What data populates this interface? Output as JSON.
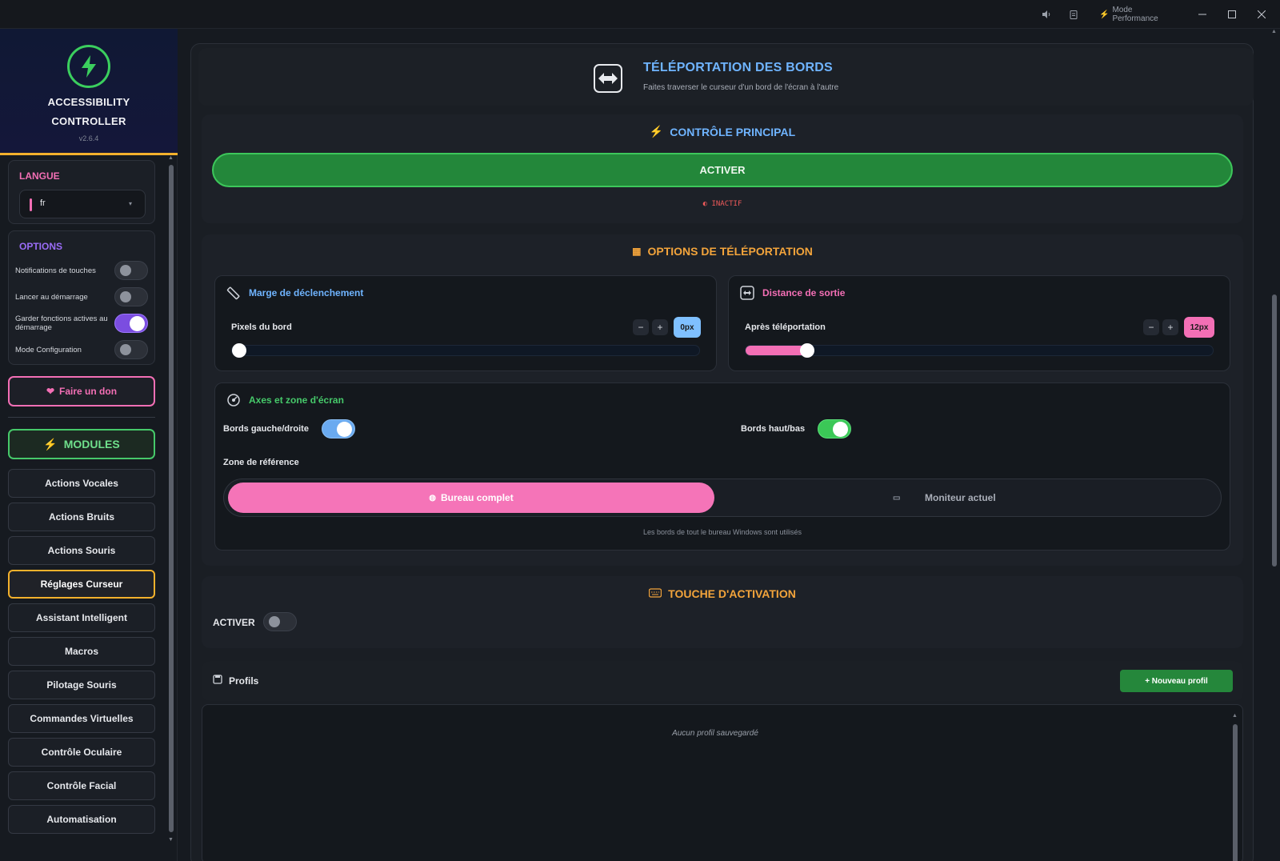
{
  "titlebar": {
    "perf_label": "Mode Performance",
    "icons": [
      "speaker-icon",
      "clipboard-icon",
      "bolt-icon",
      "minimize-icon",
      "maximize-icon",
      "close-icon"
    ]
  },
  "sidebar": {
    "brand_line1": "ACCESSIBILITY",
    "brand_line2": "CONTROLLER",
    "version": "v2.6.4",
    "language": {
      "title": "LANGUE",
      "value": "fr"
    },
    "options": {
      "title": "OPTIONS",
      "items": [
        {
          "label": "Notifications de touches",
          "on": false
        },
        {
          "label": "Lancer au démarrage",
          "on": false
        },
        {
          "label": "Garder fonctions actives au démarrage",
          "on": true
        },
        {
          "label": "Mode Configuration",
          "on": false
        }
      ]
    },
    "donate": "Faire un don",
    "modules_label": "MODULES",
    "modules": [
      "Actions Vocales",
      "Actions Bruits",
      "Actions Souris",
      "Réglages Curseur",
      "Assistant Intelligent",
      "Macros",
      "Pilotage Souris",
      "Commandes Virtuelles",
      "Contrôle Oculaire",
      "Contrôle Facial",
      "Automatisation"
    ],
    "active_module": "Réglages Curseur"
  },
  "header": {
    "title": "TÉLÉPORTATION DES BORDS",
    "subtitle": "Faites traverser le curseur d'un bord de l'écran à l'autre"
  },
  "main_control": {
    "title": "CONTRÔLE PRINCIPAL",
    "button": "ACTIVER",
    "status": "◐ INACTIF"
  },
  "teleport_options": {
    "title": "OPTIONS DE TÉLÉPORTATION",
    "trigger_margin": {
      "title": "Marge de déclenchement",
      "label": "Pixels du bord",
      "minus": "−",
      "plus": "+",
      "value_label": "0px",
      "value": 0,
      "max": 100
    },
    "exit_distance": {
      "title": "Distance de sortie",
      "label": "Après téléportation",
      "minus": "−",
      "plus": "+",
      "value_label": "12px",
      "value": 12,
      "max": 100
    },
    "axes": {
      "title": "Axes et zone d'écran",
      "left_right_label": "Bords gauche/droite",
      "left_right_on": true,
      "top_bottom_label": "Bords haut/bas",
      "top_bottom_on": true,
      "zone_label": "Zone de référence",
      "zone_option_a": "Bureau complet",
      "zone_option_b": "Moniteur actuel",
      "zone_selected": "Bureau complet",
      "hint": "Les bords de tout le bureau Windows sont utilisés"
    }
  },
  "hotkey": {
    "title": "TOUCHE D'ACTIVATION",
    "label": "ACTIVER",
    "on": false
  },
  "profiles": {
    "title": "Profils",
    "new_button": "+ Nouveau profil",
    "empty": "Aucun profil sauvegardé"
  },
  "colors": {
    "accent_blue": "#6fb4ff",
    "accent_pink": "#f36fb5",
    "accent_green": "#3dc75b",
    "accent_orange": "#f3a43b",
    "accent_purple": "#9a6cf7",
    "inactive_red": "#ee5a5a"
  }
}
